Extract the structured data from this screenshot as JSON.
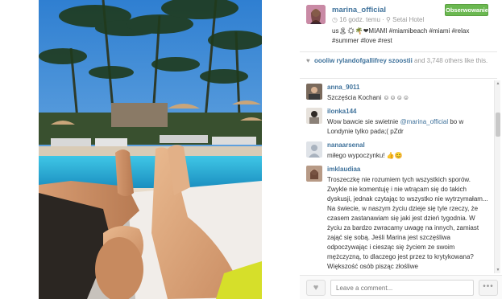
{
  "post": {
    "username": "marina_official",
    "time_ago": "16 godz. temu",
    "location_icon": "location-pin-icon",
    "location": "Setai Hotel",
    "follow_label": "Obserwowanie",
    "caption_line1": "us🏝☀🌴❤MIAMI #miamibeach #miami #relax",
    "caption_line2": "#summer #love #rest"
  },
  "likes": {
    "users": [
      "oooliw",
      "rylandofgallifrey",
      "szoostii"
    ],
    "connector": " and ",
    "count": "3,748",
    "suffix": " others like this."
  },
  "comments": [
    {
      "user": "anna_9011",
      "text": "Szczęścia Kochani ☺☺☺☺"
    },
    {
      "user": "ilonka144",
      "text_before": "Wow bawcie sie swietnie ",
      "mention": "@marina_official",
      "text_after": " bo w Londynie tylko pada;( pZdr"
    },
    {
      "user": "nanaarsenal",
      "text": "miłego wypoczynku! 👍😊"
    },
    {
      "user": "imklaudiaa",
      "text": "Troszeczkę nie rozumiem tych wszystkich sporów. Zwykle nie komentuję i nie wtrącam się do takich dyskusji, jednak czytając to wszystko nie wytrzymałam... Na świecie, w naszym życiu dzieje się tyle rzeczy, że czasem zastanawiam się jaki jest dzień tygodnia. W życiu za bardzo zwracamy uwagę na innych, zamiast zająć się sobą. Jeśli Marina jest szczęśliwa odpoczywając i ciesząc się życiem ze swoim mężczyzną, to dlaczego jest przez to krytykowana? Większość osób pisząc złośliwe"
    }
  ],
  "footer": {
    "comment_placeholder": "Leave a comment...",
    "like_icon": "heart-icon",
    "more_icon": "ellipsis-icon"
  },
  "colors": {
    "link": "#3f729b",
    "follow_green": "#6bb851",
    "muted": "#999999"
  }
}
